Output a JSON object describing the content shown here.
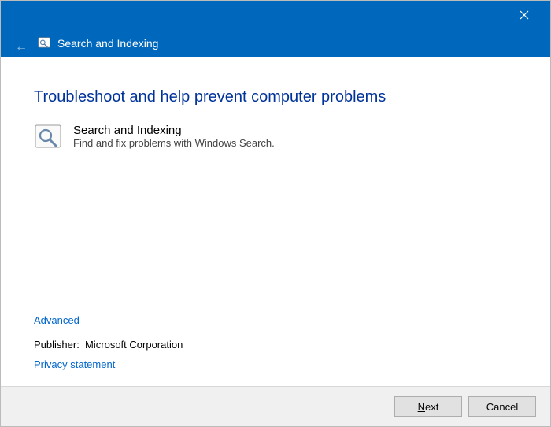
{
  "header": {
    "title": "Search and Indexing"
  },
  "content": {
    "main_heading": "Troubleshoot and help prevent computer problems",
    "item_title": "Search and Indexing",
    "item_desc": "Find and fix problems with Windows Search.",
    "advanced_link": "Advanced",
    "publisher_label": "Publisher:",
    "publisher_value": "Microsoft Corporation",
    "privacy_link": "Privacy statement"
  },
  "buttons": {
    "next_prefix": "N",
    "next_rest": "ext",
    "cancel": "Cancel"
  }
}
